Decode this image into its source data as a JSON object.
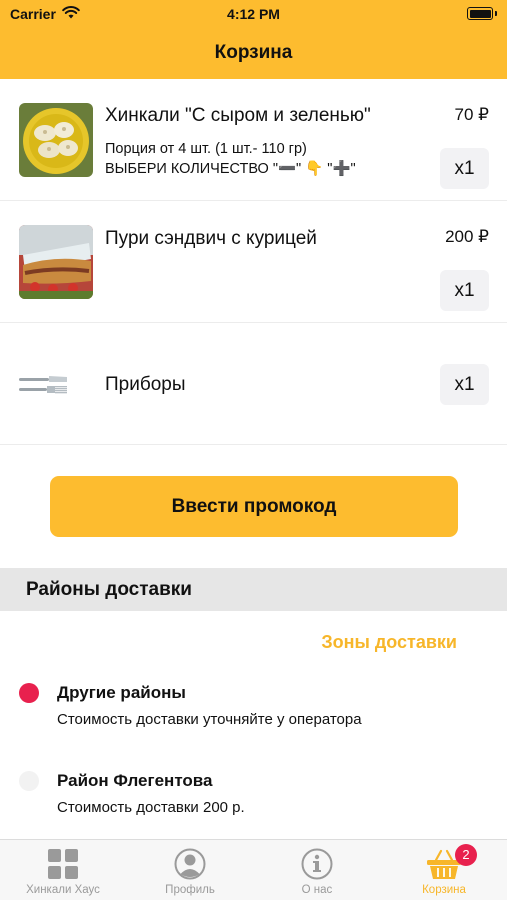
{
  "status_bar": {
    "carrier": "Carrier",
    "time": "4:12 PM"
  },
  "nav": {
    "title": "Корзина"
  },
  "cart": {
    "items": [
      {
        "name": "Хинкали \"С сыром и зеленью\"",
        "price": "70 ₽",
        "description_line1": "Порция от 4 шт. (1 шт.- 110 гр)",
        "description_line2": "ВЫБЕРИ КОЛИЧЕСТВО  \"➖\" 👇 \"➕\"",
        "quantity": "x1",
        "image": "khinkali-photo"
      },
      {
        "name": "Пури сэндвич с курицей",
        "price": "200 ₽",
        "quantity": "x1",
        "image": "sandwich-photo"
      },
      {
        "name": "Приборы",
        "quantity": "x1",
        "image": "cutlery-icon"
      }
    ]
  },
  "promo": {
    "label": "Ввести промокод"
  },
  "delivery": {
    "section_title": "Районы доставки",
    "zones_link": "Зоны доставки",
    "districts": [
      {
        "title": "Другие районы",
        "subtitle": "Стоимость доставки уточняйте у оператора",
        "selected": true
      },
      {
        "title": "Район Флегентова",
        "subtitle": "Стоимость доставки 200 р.",
        "selected": false
      }
    ]
  },
  "tabbar": {
    "tabs": [
      {
        "label": "Хинкали Хаус",
        "icon": "grid-icon"
      },
      {
        "label": "Профиль",
        "icon": "profile-icon"
      },
      {
        "label": "О нас",
        "icon": "info-icon"
      },
      {
        "label": "Корзина",
        "icon": "basket-icon",
        "badge": "2",
        "active": true
      }
    ]
  },
  "colors": {
    "accent": "#FDBC2F",
    "accent_text": "#F7B62A",
    "radio_selected": "#E8214E",
    "badge": "#E8214E"
  }
}
